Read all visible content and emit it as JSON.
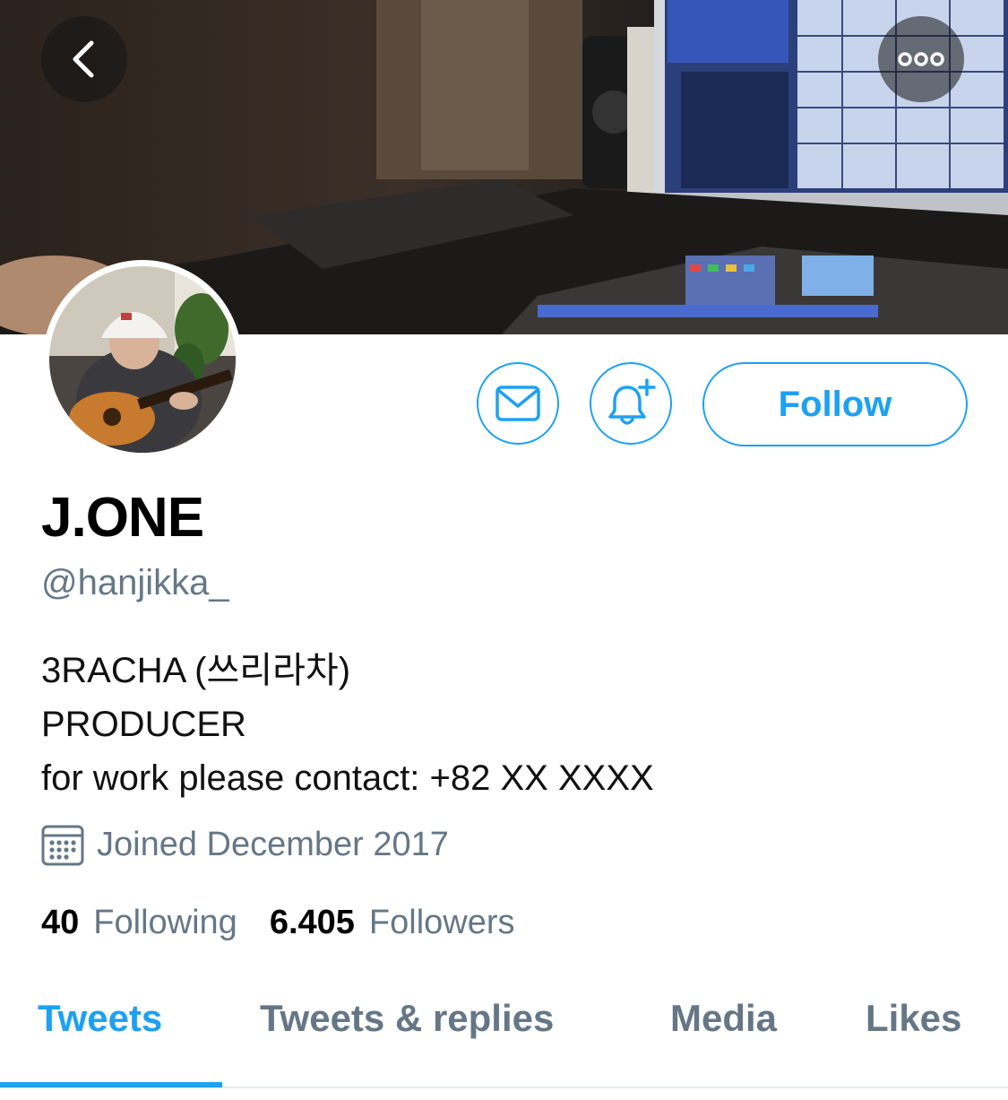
{
  "profile": {
    "name": "J.ONE",
    "handle": "@hanjikka_",
    "bio_lines": [
      "3RACHA (쓰리라차)",
      "PRODUCER",
      "for work please contact: +82 XX XXXX"
    ],
    "joined": "Joined December 2017",
    "following_count": "40",
    "following_label": "Following",
    "followers_count": "6.405",
    "followers_label": "Followers"
  },
  "actions": {
    "follow_label": "Follow",
    "message_icon": "envelope-icon",
    "notify_icon": "bell-plus-icon"
  },
  "nav": {
    "back_icon": "chevron-left-icon",
    "more_icon": "more-dots-icon"
  },
  "tabs": [
    {
      "label": "Tweets",
      "active": true
    },
    {
      "label": "Tweets & replies",
      "active": false
    },
    {
      "label": "Media",
      "active": false
    },
    {
      "label": "Likes",
      "active": false
    }
  ],
  "colors": {
    "accent": "#1da1f2",
    "secondary_text": "#657786"
  }
}
